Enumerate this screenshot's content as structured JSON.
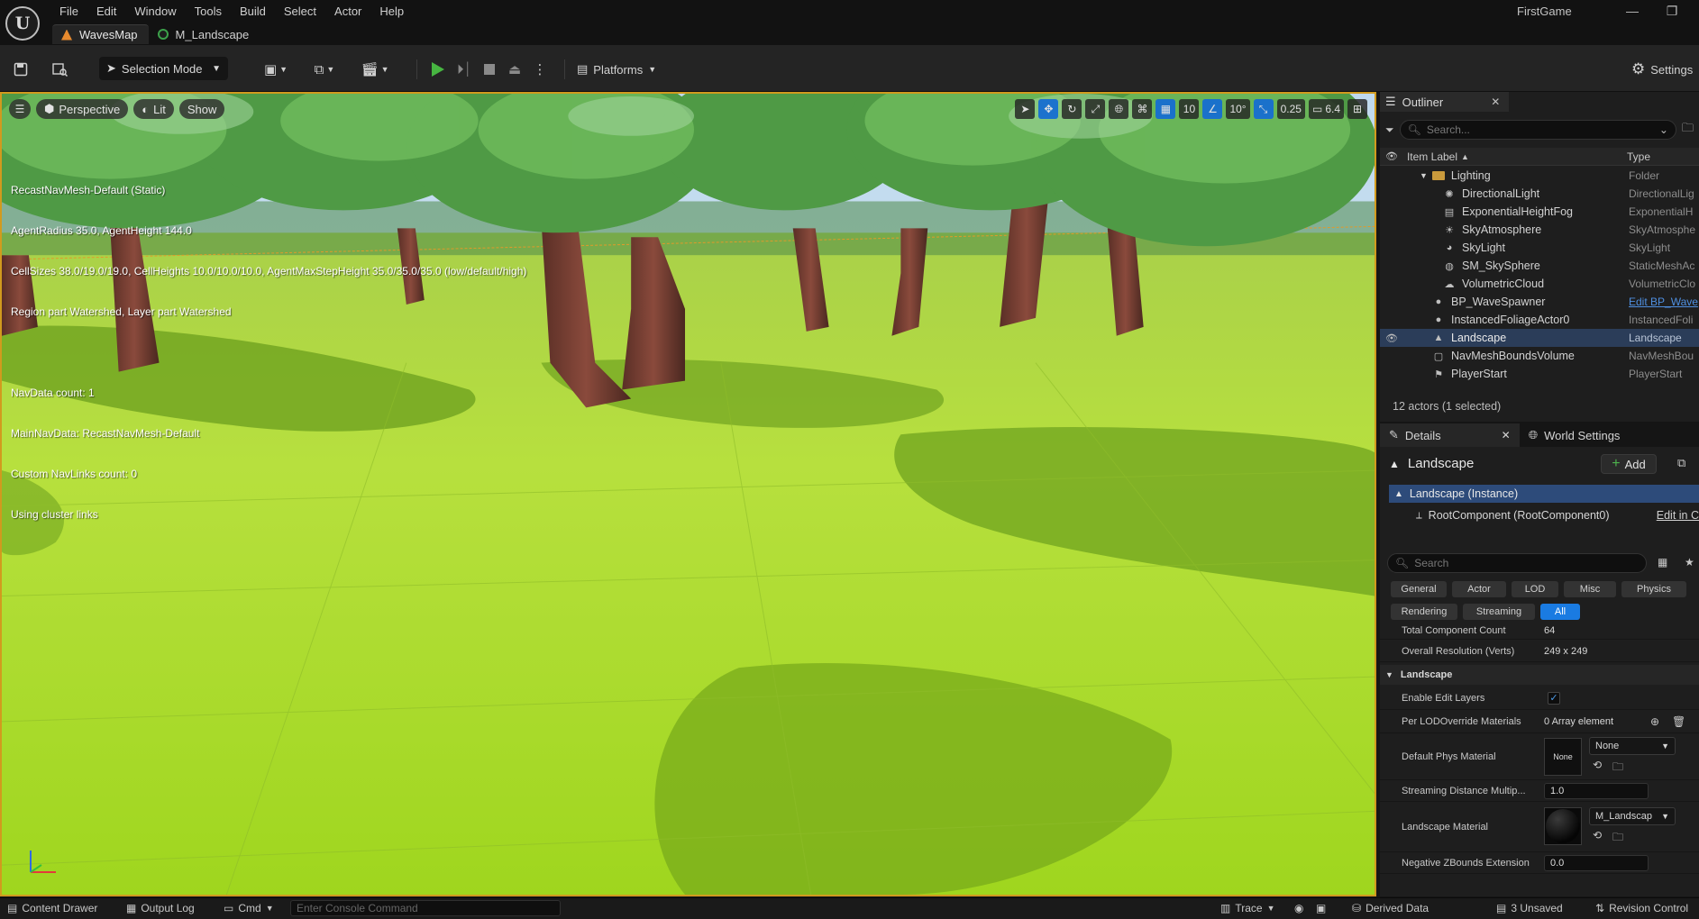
{
  "app": {
    "logo_text": "U",
    "title": "FirstGame",
    "menu": [
      "File",
      "Edit",
      "Window",
      "Tools",
      "Build",
      "Select",
      "Actor",
      "Help"
    ],
    "tabs": [
      {
        "label": "WavesMap"
      },
      {
        "label": "M_Landscape"
      }
    ]
  },
  "toolbar": {
    "selection_mode": "Selection Mode",
    "platforms": "Platforms",
    "settings": "Settings"
  },
  "viewport": {
    "perspective": "Perspective",
    "lit": "Lit",
    "show": "Show",
    "grid_size": "10",
    "rotation_snap": "10°",
    "scale_snap": "0.25",
    "camera_speed": "6.4",
    "overlay_lines": [
      "RecastNavMesh-Default (Static)",
      "AgentRadius 35.0, AgentHeight 144.0",
      "CellSizes 38.0/19.0/19.0, CellHeights 10.0/10.0/10.0, AgentMaxStepHeight 35.0/35.0/35.0 (low/default/high)",
      "Region part Watershed, Layer part Watershed",
      "",
      "NavData count: 1",
      "MainNavData: RecastNavMesh-Default",
      "Custom NavLinks count: 0",
      "Using cluster links"
    ]
  },
  "outliner": {
    "tab_label": "Outliner",
    "search_placeholder": "Search...",
    "col_label": "Item Label",
    "col_type": "Type",
    "items": [
      {
        "label": "Lighting",
        "type": "Folder",
        "icon": "folder-icon",
        "indent": 2
      },
      {
        "label": "DirectionalLight",
        "type": "DirectionalLig",
        "icon": "sun-icon",
        "indent": 3
      },
      {
        "label": "ExponentialHeightFog",
        "type": "ExponentialH",
        "icon": "fog-icon",
        "indent": 3
      },
      {
        "label": "SkyAtmosphere",
        "type": "SkyAtmosphe",
        "icon": "sky-icon",
        "indent": 3
      },
      {
        "label": "SkyLight",
        "type": "SkyLight",
        "icon": "skylight-icon",
        "indent": 3
      },
      {
        "label": "SM_SkySphere",
        "type": "StaticMeshAc",
        "icon": "mesh-icon",
        "indent": 3
      },
      {
        "label": "VolumetricCloud",
        "type": "VolumetricClo",
        "icon": "cloud-icon",
        "indent": 3
      },
      {
        "label": "BP_WaveSpawner",
        "type": "Edit BP_Wave",
        "icon": "actor-icon",
        "indent": 2,
        "link": true
      },
      {
        "label": "InstancedFoliageActor0",
        "type": "InstancedFoli",
        "icon": "actor-icon",
        "indent": 2
      },
      {
        "label": "Landscape",
        "type": "Landscape",
        "icon": "landscape-icon",
        "indent": 2,
        "selected": true
      },
      {
        "label": "NavMeshBoundsVolume",
        "type": "NavMeshBou",
        "icon": "volume-icon",
        "indent": 2
      },
      {
        "label": "PlayerStart",
        "type": "PlayerStart",
        "icon": "flag-icon",
        "indent": 2
      }
    ],
    "status": "12 actors (1 selected)"
  },
  "details": {
    "tab_label": "Details",
    "world_settings_label": "World Settings",
    "object_name": "Landscape",
    "add_label": "Add",
    "instance_label": "Landscape (Instance)",
    "root_component": "RootComponent (RootComponent0)",
    "root_link": "Edit in C",
    "search_placeholder": "Search",
    "filters_row1": [
      "General",
      "Actor",
      "LOD",
      "Misc",
      "Physics"
    ],
    "filters_row2": [
      "Rendering",
      "Streaming",
      "All"
    ],
    "props": {
      "total_component_count_label": "Total Component Count",
      "total_component_count_value": "64",
      "overall_resolution_label": "Overall Resolution (Verts)",
      "overall_resolution_value": "249 x 249",
      "landscape_category": "Landscape",
      "enable_edit_layers_label": "Enable Edit Layers",
      "enable_edit_layers_checked": "✓",
      "per_lod_label": "Per LODOverride Materials",
      "per_lod_value": "0 Array element",
      "default_phys_label": "Default Phys Material",
      "default_phys_thumb": "None",
      "default_phys_value": "None",
      "streaming_dist_label": "Streaming Distance Multip...",
      "streaming_dist_value": "1.0",
      "landscape_material_label": "Landscape Material",
      "landscape_material_value": "M_Landscap",
      "negative_z_label": "Negative ZBounds Extension",
      "negative_z_value": "0.0"
    }
  },
  "statusbar": {
    "content_drawer": "Content Drawer",
    "output_log": "Output Log",
    "cmd": "Cmd",
    "console_placeholder": "Enter Console Command",
    "trace": "Trace",
    "derived_data": "Derived Data",
    "unsaved": "3 Unsaved",
    "revision_control": "Revision Control"
  }
}
